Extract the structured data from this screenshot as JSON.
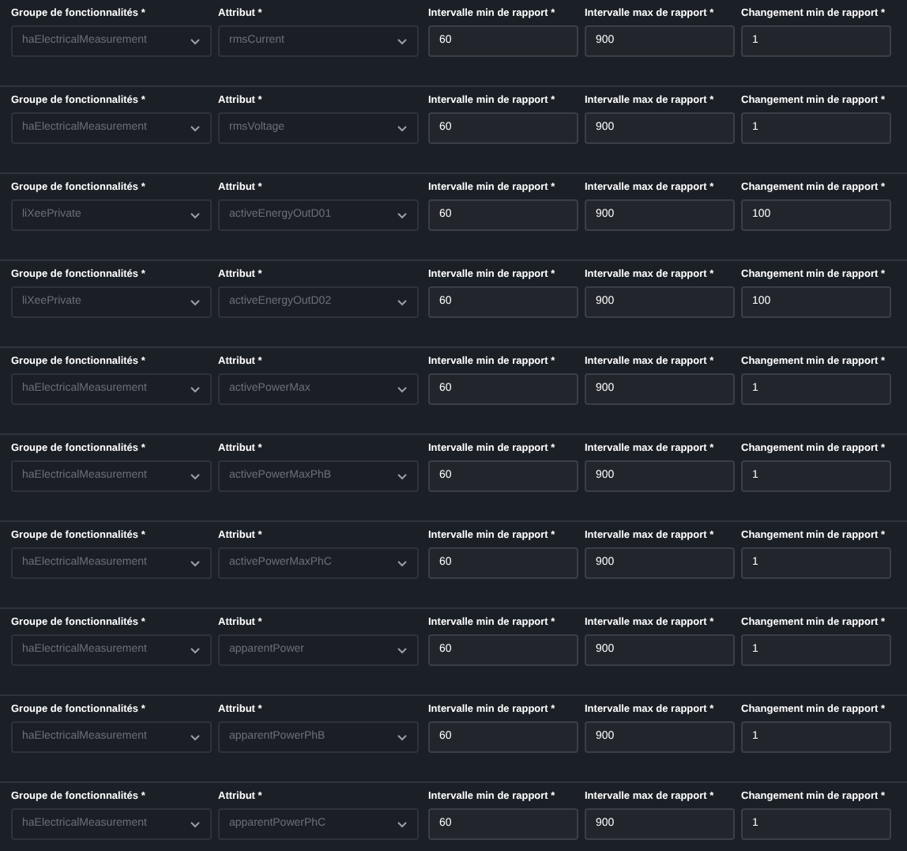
{
  "rows": [
    {
      "fields": [
        {
          "kind": "select",
          "label": "Groupe de fonctionnalités *",
          "value": "haElectricalMeasurement",
          "disabled": true
        },
        {
          "kind": "select",
          "label": "Attribut *",
          "value": "rmsCurrent",
          "disabled": true
        },
        {
          "kind": "number",
          "label": "Intervalle min de rapport *",
          "value": "60"
        },
        {
          "kind": "number",
          "label": "Intervalle max de rapport *",
          "value": "900"
        },
        {
          "kind": "number",
          "label": "Changement min de rapport *",
          "value": "1"
        }
      ]
    },
    {
      "fields": [
        {
          "kind": "select",
          "label": "Groupe de fonctionnalités *",
          "value": "haElectricalMeasurement",
          "disabled": true
        },
        {
          "kind": "select",
          "label": "Attribut *",
          "value": "rmsVoltage",
          "disabled": true
        },
        {
          "kind": "number",
          "label": "Intervalle min de rapport *",
          "value": "60"
        },
        {
          "kind": "number",
          "label": "Intervalle max de rapport *",
          "value": "900"
        },
        {
          "kind": "number",
          "label": "Changement min de rapport *",
          "value": "1"
        }
      ]
    },
    {
      "fields": [
        {
          "kind": "select",
          "label": "Groupe de fonctionnalités *",
          "value": "liXeePrivate",
          "disabled": true
        },
        {
          "kind": "select",
          "label": "Attribut *",
          "value": "activeEnergyOutD01",
          "disabled": true
        },
        {
          "kind": "number",
          "label": "Intervalle min de rapport *",
          "value": "60"
        },
        {
          "kind": "number",
          "label": "Intervalle max de rapport *",
          "value": "900"
        },
        {
          "kind": "number",
          "label": "Changement min de rapport *",
          "value": "100"
        }
      ]
    },
    {
      "fields": [
        {
          "kind": "select",
          "label": "Groupe de fonctionnalités *",
          "value": "liXeePrivate",
          "disabled": true
        },
        {
          "kind": "select",
          "label": "Attribut *",
          "value": "activeEnergyOutD02",
          "disabled": true
        },
        {
          "kind": "number",
          "label": "Intervalle min de rapport *",
          "value": "60"
        },
        {
          "kind": "number",
          "label": "Intervalle max de rapport *",
          "value": "900"
        },
        {
          "kind": "number",
          "label": "Changement min de rapport *",
          "value": "100"
        }
      ]
    },
    {
      "fields": [
        {
          "kind": "select",
          "label": "Groupe de fonctionnalités *",
          "value": "haElectricalMeasurement",
          "disabled": true
        },
        {
          "kind": "select",
          "label": "Attribut *",
          "value": "activePowerMax",
          "disabled": true
        },
        {
          "kind": "number",
          "label": "Intervalle min de rapport *",
          "value": "60"
        },
        {
          "kind": "number",
          "label": "Intervalle max de rapport *",
          "value": "900"
        },
        {
          "kind": "number",
          "label": "Changement min de rapport *",
          "value": "1"
        }
      ]
    },
    {
      "fields": [
        {
          "kind": "select",
          "label": "Groupe de fonctionnalités *",
          "value": "haElectricalMeasurement",
          "disabled": true
        },
        {
          "kind": "select",
          "label": "Attribut *",
          "value": "activePowerMaxPhB",
          "disabled": true
        },
        {
          "kind": "number",
          "label": "Intervalle min de rapport *",
          "value": "60"
        },
        {
          "kind": "number",
          "label": "Intervalle max de rapport *",
          "value": "900"
        },
        {
          "kind": "number",
          "label": "Changement min de rapport *",
          "value": "1"
        }
      ]
    },
    {
      "fields": [
        {
          "kind": "select",
          "label": "Groupe de fonctionnalités *",
          "value": "haElectricalMeasurement",
          "disabled": true
        },
        {
          "kind": "select",
          "label": "Attribut *",
          "value": "activePowerMaxPhC",
          "disabled": true
        },
        {
          "kind": "number",
          "label": "Intervalle min de rapport *",
          "value": "60"
        },
        {
          "kind": "number",
          "label": "Intervalle max de rapport *",
          "value": "900"
        },
        {
          "kind": "number",
          "label": "Changement min de rapport *",
          "value": "1"
        }
      ]
    },
    {
      "fields": [
        {
          "kind": "select",
          "label": "Groupe de fonctionnalités *",
          "value": "haElectricalMeasurement",
          "disabled": true
        },
        {
          "kind": "select",
          "label": "Attribut *",
          "value": "apparentPower",
          "disabled": true
        },
        {
          "kind": "number",
          "label": "Intervalle min de rapport *",
          "value": "60"
        },
        {
          "kind": "number",
          "label": "Intervalle max de rapport *",
          "value": "900"
        },
        {
          "kind": "number",
          "label": "Changement min de rapport *",
          "value": "1"
        }
      ]
    },
    {
      "fields": [
        {
          "kind": "select",
          "label": "Groupe de fonctionnalités *",
          "value": "haElectricalMeasurement",
          "disabled": true
        },
        {
          "kind": "select",
          "label": "Attribut *",
          "value": "apparentPowerPhB",
          "disabled": true
        },
        {
          "kind": "number",
          "label": "Intervalle min de rapport *",
          "value": "60"
        },
        {
          "kind": "number",
          "label": "Intervalle max de rapport *",
          "value": "900"
        },
        {
          "kind": "number",
          "label": "Changement min de rapport *",
          "value": "1"
        }
      ]
    },
    {
      "fields": [
        {
          "kind": "select",
          "label": "Groupe de fonctionnalités *",
          "value": "haElectricalMeasurement",
          "disabled": true
        },
        {
          "kind": "select",
          "label": "Attribut *",
          "value": "apparentPowerPhC",
          "disabled": true
        },
        {
          "kind": "number",
          "label": "Intervalle min de rapport *",
          "value": "60"
        },
        {
          "kind": "number",
          "label": "Intervalle max de rapport *",
          "value": "900"
        },
        {
          "kind": "number",
          "label": "Changement min de rapport *",
          "value": "1"
        }
      ]
    }
  ]
}
